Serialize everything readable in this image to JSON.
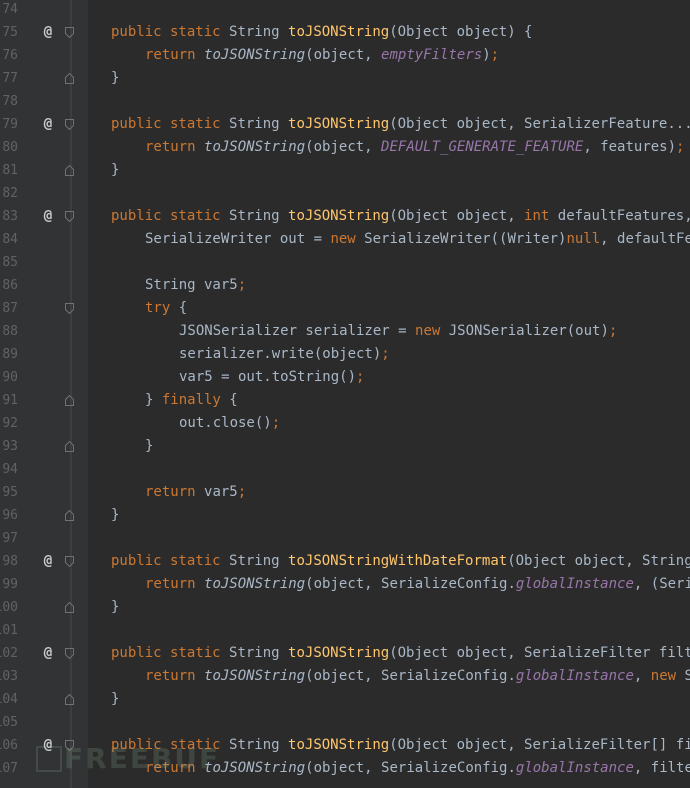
{
  "editor": {
    "lines": [
      {
        "num": "74",
        "tokens": []
      },
      {
        "num": "75",
        "mark": "@",
        "fold": "down",
        "tokens": [
          {
            "t": "public static ",
            "c": "kw"
          },
          {
            "t": "String "
          },
          {
            "t": "toJSONString",
            "c": "fn"
          },
          {
            "t": "(Object object) {"
          }
        ]
      },
      {
        "num": "76",
        "indent": 1,
        "tokens": [
          {
            "t": "return ",
            "c": "kw"
          },
          {
            "t": "toJSONString",
            "c": "it"
          },
          {
            "t": "(object, "
          },
          {
            "t": "emptyFilters",
            "c": "st"
          },
          {
            "t": ")"
          },
          {
            "t": ";",
            "c": "kw"
          }
        ]
      },
      {
        "num": "77",
        "fold": "up",
        "tokens": [
          {
            "t": "}"
          }
        ]
      },
      {
        "num": "78",
        "tokens": []
      },
      {
        "num": "79",
        "mark": "@",
        "fold": "down",
        "tokens": [
          {
            "t": "public static ",
            "c": "kw"
          },
          {
            "t": "String "
          },
          {
            "t": "toJSONString",
            "c": "fn"
          },
          {
            "t": "(Object object, SerializerFeature... features) {"
          }
        ]
      },
      {
        "num": "80",
        "indent": 1,
        "tokens": [
          {
            "t": "return ",
            "c": "kw"
          },
          {
            "t": "toJSONString",
            "c": "it"
          },
          {
            "t": "(object, "
          },
          {
            "t": "DEFAULT_GENERATE_FEATURE",
            "c": "st"
          },
          {
            "t": ", features)"
          },
          {
            "t": ";",
            "c": "kw"
          }
        ]
      },
      {
        "num": "81",
        "fold": "up",
        "tokens": [
          {
            "t": "}"
          }
        ]
      },
      {
        "num": "82",
        "tokens": []
      },
      {
        "num": "83",
        "mark": "@",
        "fold": "down",
        "tokens": [
          {
            "t": "public static ",
            "c": "kw"
          },
          {
            "t": "String "
          },
          {
            "t": "toJSONString",
            "c": "fn"
          },
          {
            "t": "(Object object, "
          },
          {
            "t": "int ",
            "c": "kw"
          },
          {
            "t": "defaultFeatures, SerializerFeature... features) {"
          }
        ]
      },
      {
        "num": "84",
        "indent": 1,
        "tokens": [
          {
            "t": "SerializeWriter out = "
          },
          {
            "t": "new ",
            "c": "kw"
          },
          {
            "t": "SerializeWriter((Writer)"
          },
          {
            "t": "null",
            "c": "kw"
          },
          {
            "t": ", defaultFeatures, features);"
          }
        ]
      },
      {
        "num": "85",
        "tokens": []
      },
      {
        "num": "86",
        "indent": 1,
        "tokens": [
          {
            "t": "String var5"
          },
          {
            "t": ";",
            "c": "kw"
          }
        ]
      },
      {
        "num": "87",
        "indent": 1,
        "fold": "down",
        "tokens": [
          {
            "t": "try ",
            "c": "kw"
          },
          {
            "t": "{"
          }
        ]
      },
      {
        "num": "88",
        "indent": 2,
        "tokens": [
          {
            "t": "JSONSerializer serializer = "
          },
          {
            "t": "new ",
            "c": "kw"
          },
          {
            "t": "JSONSerializer(out)"
          },
          {
            "t": ";",
            "c": "kw"
          }
        ]
      },
      {
        "num": "89",
        "indent": 2,
        "tokens": [
          {
            "t": "serializer.write(object)"
          },
          {
            "t": ";",
            "c": "kw"
          }
        ]
      },
      {
        "num": "90",
        "indent": 2,
        "tokens": [
          {
            "t": "var5 = out.toString()"
          },
          {
            "t": ";",
            "c": "kw"
          }
        ]
      },
      {
        "num": "91",
        "indent": 1,
        "fold": "up",
        "tokens": [
          {
            "t": "} "
          },
          {
            "t": "finally ",
            "c": "kw"
          },
          {
            "t": "{"
          }
        ]
      },
      {
        "num": "92",
        "indent": 2,
        "tokens": [
          {
            "t": "out.close()"
          },
          {
            "t": ";",
            "c": "kw"
          }
        ]
      },
      {
        "num": "93",
        "indent": 1,
        "fold": "up",
        "tokens": [
          {
            "t": "}"
          }
        ]
      },
      {
        "num": "94",
        "tokens": []
      },
      {
        "num": "95",
        "indent": 1,
        "tokens": [
          {
            "t": "return ",
            "c": "kw"
          },
          {
            "t": "var5"
          },
          {
            "t": ";",
            "c": "kw"
          }
        ]
      },
      {
        "num": "96",
        "fold": "up",
        "tokens": [
          {
            "t": "}"
          }
        ]
      },
      {
        "num": "97",
        "tokens": []
      },
      {
        "num": "98",
        "mark": "@",
        "fold": "down",
        "tokens": [
          {
            "t": "public static ",
            "c": "kw"
          },
          {
            "t": "String "
          },
          {
            "t": "toJSONStringWithDateFormat",
            "c": "fn"
          },
          {
            "t": "(Object object, String dateFormat) {"
          }
        ]
      },
      {
        "num": "99",
        "indent": 1,
        "tokens": [
          {
            "t": "return ",
            "c": "kw"
          },
          {
            "t": "toJSONString",
            "c": "it"
          },
          {
            "t": "(object, SerializeConfig."
          },
          {
            "t": "globalInstance",
            "c": "st"
          },
          {
            "t": ", (SerializeFilter[])"
          }
        ]
      },
      {
        "num": "100",
        "fold": "up",
        "tokens": [
          {
            "t": "}"
          }
        ]
      },
      {
        "num": "101",
        "tokens": []
      },
      {
        "num": "102",
        "mark": "@",
        "fold": "down",
        "tokens": [
          {
            "t": "public static ",
            "c": "kw"
          },
          {
            "t": "String "
          },
          {
            "t": "toJSONString",
            "c": "fn"
          },
          {
            "t": "(Object object, SerializeFilter filter) {"
          }
        ]
      },
      {
        "num": "103",
        "indent": 1,
        "tokens": [
          {
            "t": "return ",
            "c": "kw"
          },
          {
            "t": "toJSONString",
            "c": "it"
          },
          {
            "t": "(object, SerializeConfig."
          },
          {
            "t": "globalInstance",
            "c": "st"
          },
          {
            "t": ", "
          },
          {
            "t": "new ",
            "c": "kw"
          },
          {
            "t": "SerializeFilter[]"
          }
        ]
      },
      {
        "num": "104",
        "fold": "up",
        "tokens": [
          {
            "t": "}"
          }
        ]
      },
      {
        "num": "105",
        "tokens": []
      },
      {
        "num": "106",
        "mark": "@",
        "fold": "down",
        "tokens": [
          {
            "t": "public static ",
            "c": "kw"
          },
          {
            "t": "String "
          },
          {
            "t": "toJSONString",
            "c": "fn"
          },
          {
            "t": "(Object object, SerializeFilter[] filters) {"
          }
        ]
      },
      {
        "num": "107",
        "indent": 1,
        "tokens": [
          {
            "t": "return ",
            "c": "kw"
          },
          {
            "t": "toJSONString",
            "c": "it"
          },
          {
            "t": "(object, SerializeConfig."
          },
          {
            "t": "globalInstance",
            "c": "st"
          },
          {
            "t": ", filters)"
          }
        ]
      }
    ]
  },
  "watermark": {
    "text": "FREEBUF"
  }
}
